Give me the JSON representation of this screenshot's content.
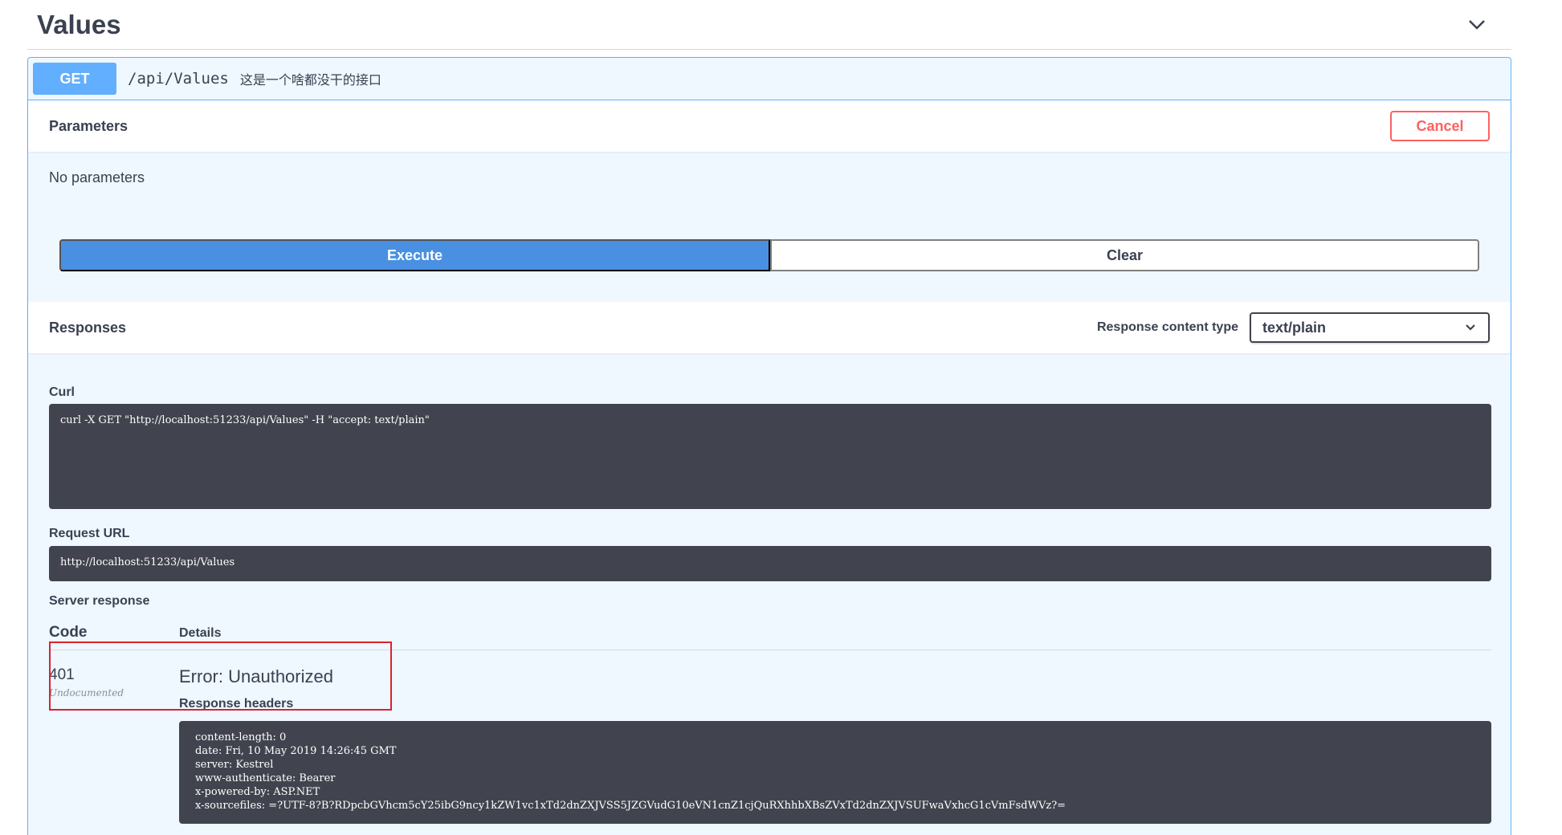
{
  "tag": {
    "title": "Values"
  },
  "operation": {
    "method": "GET",
    "path": "/api/Values",
    "description": "这是一个啥都没干的接口"
  },
  "parameters": {
    "title": "Parameters",
    "cancel_label": "Cancel",
    "empty_text": "No parameters",
    "execute_label": "Execute",
    "clear_label": "Clear"
  },
  "responses": {
    "title": "Responses",
    "content_type_label": "Response content type",
    "content_type_value": "text/plain",
    "curl_label": "Curl",
    "curl_command": "curl -X GET \"http://localhost:51233/api/Values\" -H \"accept: text/plain\"",
    "request_url_label": "Request URL",
    "request_url": "http://localhost:51233/api/Values",
    "server_response_label": "Server response",
    "code_header": "Code",
    "details_header": "Details",
    "status_code": "401",
    "status_note": "Undocumented",
    "error_text": "Error: Unauthorized",
    "response_headers_label": "Response headers",
    "response_headers": [
      "content-length: 0",
      "date: Fri, 10 May 2019 14:26:45 GMT",
      "server: Kestrel",
      "www-authenticate: Bearer",
      "x-powered-by: ASP.NET",
      "x-sourcefiles: =?UTF-8?B?RDpcbGVhcm5cY25ibG9ncy1kZW1vc1xTd2dnZXJVSS5JZGVudG10eVN1cnZ1cjQuRXhhbXBsZVxTd2dnZXJVSUFwaVxhcG1cVmFsdWVz?="
    ]
  },
  "colors": {
    "get_accent": "#61affe",
    "execute": "#4990e2",
    "cancel": "#ff6060",
    "code_bg": "#41444e",
    "highlight": "#d9232d"
  }
}
